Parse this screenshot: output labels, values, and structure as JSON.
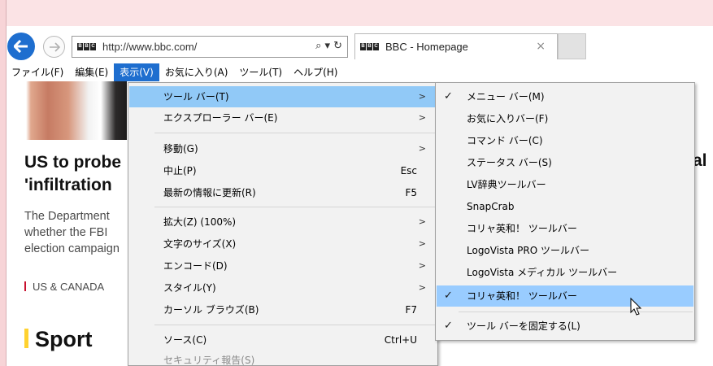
{
  "browser": {
    "url": "http://www.bbc.com/",
    "tab_title": "BBC - Homepage",
    "tab_close": "×",
    "favicon_letters": [
      "B",
      "B",
      "C"
    ],
    "search_glyph": "⌕ ▾",
    "refresh_glyph": "↻"
  },
  "menubar": {
    "items": [
      "ファイル(F)",
      "編集(E)",
      "表示(V)",
      "お気に入り(A)",
      "ツール(T)",
      "ヘルプ(H)"
    ],
    "active": "表示(V)"
  },
  "page": {
    "headline_line1": "US to probe",
    "headline_line2": "'infiltration",
    "headline_tail": "al",
    "summary_lines": [
      "The Department",
      "whether the FBI",
      "election campaign"
    ],
    "tag": "US & CANADA",
    "section": "Sport"
  },
  "view_menu": {
    "items": [
      {
        "label": "ツール バー(T)",
        "submenu": true
      },
      {
        "label": "エクスプローラー バー(E)",
        "submenu": true
      },
      {
        "label": "移動(G)",
        "submenu": true
      },
      {
        "label": "中止(P)",
        "shortcut": "Esc"
      },
      {
        "label": "最新の情報に更新(R)",
        "shortcut": "F5"
      },
      {
        "label": "拡大(Z) (100%)",
        "submenu": true
      },
      {
        "label": "文字のサイズ(X)",
        "submenu": true
      },
      {
        "label": "エンコード(D)",
        "submenu": true
      },
      {
        "label": "スタイル(Y)",
        "submenu": true
      },
      {
        "label": "カーソル ブラウズ(B)",
        "shortcut": "F7"
      },
      {
        "label": "ソース(C)",
        "shortcut": "Ctrl+U"
      },
      {
        "label": "セキュリティ報告(S)"
      }
    ],
    "arrow": ">"
  },
  "toolbar_submenu": {
    "check_glyph": "✓",
    "items": [
      {
        "label": "メニュー バー(M)",
        "checked": true
      },
      {
        "label": "お気に入りバー(F)",
        "checked": false
      },
      {
        "label": "コマンド バー(C)",
        "checked": false
      },
      {
        "label": "ステータス バー(S)",
        "checked": false
      },
      {
        "label": "LV辞典ツールバー",
        "checked": false
      },
      {
        "label": "SnapCrab",
        "checked": false
      },
      {
        "label": "コリャ英和！ ツールバー",
        "checked": false
      },
      {
        "label": "LogoVista PRO ツールバー",
        "checked": false
      },
      {
        "label": "LogoVista メディカル ツールバー",
        "checked": false
      },
      {
        "label": "コリャ英和！ ツールバー",
        "checked": true
      },
      {
        "label": "ツール バーを固定する(L)",
        "checked": true
      }
    ]
  },
  "colors": {
    "accent": "#1e6ecf",
    "highlight": "#91c9f7",
    "menu_bg": "#f2f2f2",
    "bbc_red": "#c8102e",
    "sport_yellow": "#ffd230"
  }
}
